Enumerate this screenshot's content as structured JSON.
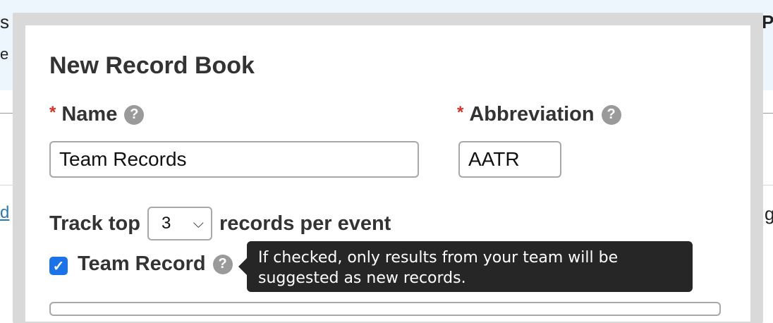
{
  "background": {
    "fragments": {
      "top_left_1": "s",
      "top_left_2": "e",
      "top_right": "P",
      "mid_left_link": "d",
      "mid_right": "g"
    }
  },
  "modal": {
    "title": "New Record Book",
    "name_label": "Name",
    "name_value": "Team Records",
    "abbr_label": "Abbreviation",
    "abbr_value": "AATR",
    "required_marker": "*",
    "help_glyph": "?",
    "track_prefix": "Track top",
    "track_value": "3",
    "track_suffix": "records per event",
    "team_record_label": "Team Record",
    "team_record_checked": true,
    "tooltip_text": "If checked, only results from your team will be suggested as new records."
  },
  "colors": {
    "required": "#d93025",
    "checkbox": "#1a73e8",
    "tooltip_bg": "#262626",
    "background_band": "#eef6fd"
  }
}
